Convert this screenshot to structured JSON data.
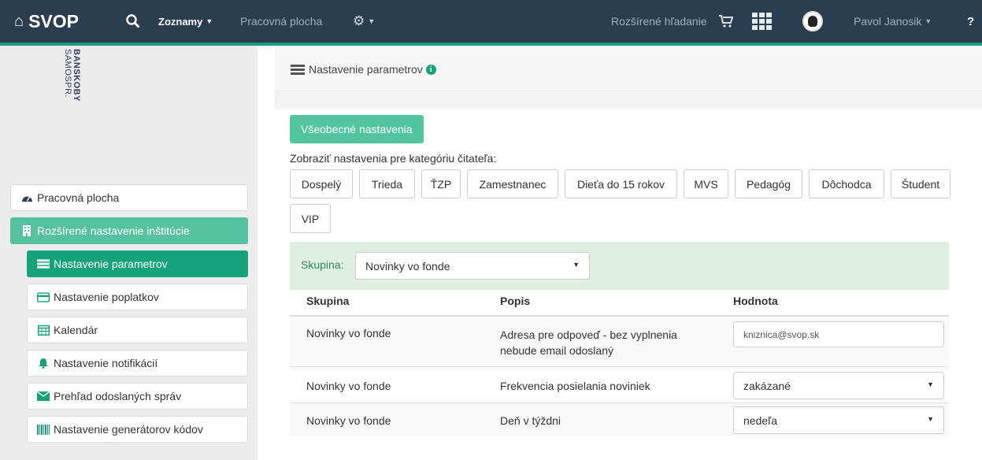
{
  "navbar": {
    "brand": "SVOP",
    "lists": "Zoznamy",
    "desktop": "Pracovná plocha",
    "advanced_search": "Rozšírené hľadanie",
    "user": "Pavol Janosik",
    "help": "?"
  },
  "sidebar": {
    "logo_line1": "BANSKOBY",
    "logo_line2": "SAMOSPR.",
    "items": [
      {
        "label": "Pracovná plocha",
        "icon": "dashboard-icon"
      },
      {
        "label": "Rozšírené nastavenie inštitúcie",
        "icon": "building-icon"
      },
      {
        "label": "Nastavenie parametrov",
        "icon": "server-icon"
      },
      {
        "label": "Nastavenie poplatkov",
        "icon": "credit-card-icon"
      },
      {
        "label": "Kalendár",
        "icon": "calendar-icon"
      },
      {
        "label": "Nastavenie notifikácií",
        "icon": "bell-icon"
      },
      {
        "label": "Prehľad odoslaných správ",
        "icon": "envelope-icon"
      },
      {
        "label": "Nastavenie generátorov kódov",
        "icon": "barcode-icon"
      }
    ]
  },
  "main": {
    "title": "Nastavenie parametrov",
    "general_button": "Všeobecné nastavenia",
    "category_label": "Zobraziť nastavenia pre kategóriu čitateľa:",
    "categories": [
      "Dospelý",
      "Trieda",
      "ŤZP",
      "Zamestnanec",
      "Dieťa do 15 rokov",
      "MVS",
      "Pedagóg",
      "Dôchodca",
      "Študent",
      "VIP"
    ],
    "filter": {
      "label": "Skupina:",
      "value": "Novinky vo fonde"
    },
    "table": {
      "headers": [
        "Skupina",
        "Popis",
        "Hodnota"
      ],
      "rows": [
        {
          "group": "Novinky vo fonde",
          "desc_line1": "Adresa pre odpoveď - bez vyplnenia",
          "desc_line2": "nebude email odoslaný",
          "value": "kniznica@svop.sk"
        },
        {
          "group": "Novinky vo fonde",
          "desc_line1": "Frekvencia posielania noviniek",
          "value": "zakázané"
        },
        {
          "group": "Novinky vo fonde",
          "desc_line1": "Deň v týždni",
          "value": "nedeľa"
        }
      ]
    }
  }
}
